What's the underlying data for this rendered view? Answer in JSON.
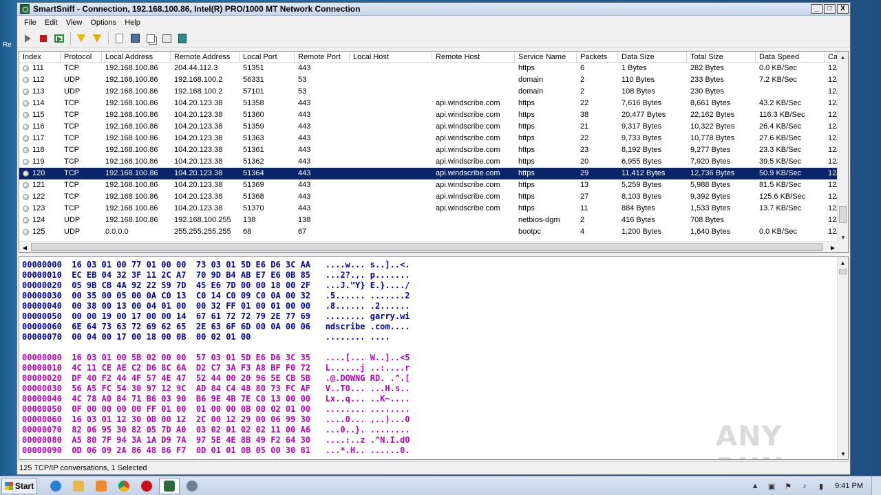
{
  "window": {
    "title": "SmartSniff - Connection, 192.168.100.86, Intel(R) PRO/1000 MT Network Connection",
    "minimize": "_",
    "maximize": "□",
    "close": "X"
  },
  "menu": [
    "File",
    "Edit",
    "View",
    "Options",
    "Help"
  ],
  "toolbar_icons": [
    "play-icon",
    "stop-icon",
    "start-capture-icon",
    "filter-icon",
    "filter-alt-icon",
    "new-doc-icon",
    "save-icon",
    "copy-icon",
    "properties-icon",
    "exit-icon"
  ],
  "columns": [
    "Index",
    "Protocol",
    "Local Address",
    "Remote Address",
    "Local Port",
    "Remote Port",
    "Local Host",
    "Remote Host",
    "Service Name",
    "Packets",
    "Data Size",
    "Total Size",
    "Data Speed",
    "Ca"
  ],
  "rows": [
    {
      "index": "111",
      "protocol": "TCP",
      "local_address": "192.168.100.86",
      "remote_address": "204.44.112.3",
      "local_port": "51351",
      "remote_port": "443",
      "local_host": "",
      "remote_host": "",
      "service": "https",
      "packets": "6",
      "data_size": "1 Bytes",
      "total_size": "282 Bytes",
      "speed": "0.0 KB/Sec",
      "ca": "12/"
    },
    {
      "index": "112",
      "protocol": "UDP",
      "local_address": "192.168.100.86",
      "remote_address": "192.168.100.2",
      "local_port": "56331",
      "remote_port": "53",
      "local_host": "",
      "remote_host": "",
      "service": "domain",
      "packets": "2",
      "data_size": "110 Bytes",
      "total_size": "233 Bytes",
      "speed": "7.2 KB/Sec",
      "ca": "12/"
    },
    {
      "index": "113",
      "protocol": "UDP",
      "local_address": "192.168.100.86",
      "remote_address": "192.168.100.2",
      "local_port": "57101",
      "remote_port": "53",
      "local_host": "",
      "remote_host": "",
      "service": "domain",
      "packets": "2",
      "data_size": "108 Bytes",
      "total_size": "230 Bytes",
      "speed": "",
      "ca": "12/"
    },
    {
      "index": "114",
      "protocol": "TCP",
      "local_address": "192.168.100.86",
      "remote_address": "104.20.123.38",
      "local_port": "51358",
      "remote_port": "443",
      "local_host": "",
      "remote_host": "api.windscribe.com",
      "service": "https",
      "packets": "22",
      "data_size": "7,616 Bytes",
      "total_size": "8,661 Bytes",
      "speed": "43.2 KB/Sec",
      "ca": "12/"
    },
    {
      "index": "115",
      "protocol": "TCP",
      "local_address": "192.168.100.86",
      "remote_address": "104.20.123.38",
      "local_port": "51360",
      "remote_port": "443",
      "local_host": "",
      "remote_host": "api.windscribe.com",
      "service": "https",
      "packets": "38",
      "data_size": "20,477 Bytes",
      "total_size": "22,162 Bytes",
      "speed": "116.3 KB/Sec",
      "ca": "12/"
    },
    {
      "index": "116",
      "protocol": "TCP",
      "local_address": "192.168.100.86",
      "remote_address": "104.20.123.38",
      "local_port": "51359",
      "remote_port": "443",
      "local_host": "",
      "remote_host": "api.windscribe.com",
      "service": "https",
      "packets": "21",
      "data_size": "9,317 Bytes",
      "total_size": "10,322 Bytes",
      "speed": "26.4 KB/Sec",
      "ca": "12/"
    },
    {
      "index": "117",
      "protocol": "TCP",
      "local_address": "192.168.100.86",
      "remote_address": "104.20.123.38",
      "local_port": "51363",
      "remote_port": "443",
      "local_host": "",
      "remote_host": "api.windscribe.com",
      "service": "https",
      "packets": "22",
      "data_size": "9,733 Bytes",
      "total_size": "10,778 Bytes",
      "speed": "27.6 KB/Sec",
      "ca": "12/"
    },
    {
      "index": "118",
      "protocol": "TCP",
      "local_address": "192.168.100.86",
      "remote_address": "104.20.123.38",
      "local_port": "51361",
      "remote_port": "443",
      "local_host": "",
      "remote_host": "api.windscribe.com",
      "service": "https",
      "packets": "23",
      "data_size": "8,192 Bytes",
      "total_size": "9,277 Bytes",
      "speed": "23.3 KB/Sec",
      "ca": "12/"
    },
    {
      "index": "119",
      "protocol": "TCP",
      "local_address": "192.168.100.86",
      "remote_address": "104.20.123.38",
      "local_port": "51362",
      "remote_port": "443",
      "local_host": "",
      "remote_host": "api.windscribe.com",
      "service": "https",
      "packets": "20",
      "data_size": "6,955 Bytes",
      "total_size": "7,920 Bytes",
      "speed": "39.5 KB/Sec",
      "ca": "12/"
    },
    {
      "index": "120",
      "protocol": "TCP",
      "local_address": "192.168.100.86",
      "remote_address": "104.20.123.38",
      "local_port": "51364",
      "remote_port": "443",
      "local_host": "",
      "remote_host": "api.windscribe.com",
      "service": "https",
      "packets": "29",
      "data_size": "11,412 Bytes",
      "total_size": "12,736 Bytes",
      "speed": "50.9 KB/Sec",
      "ca": "12/",
      "selected": true
    },
    {
      "index": "121",
      "protocol": "TCP",
      "local_address": "192.168.100.86",
      "remote_address": "104.20.123.38",
      "local_port": "51369",
      "remote_port": "443",
      "local_host": "",
      "remote_host": "api.windscribe.com",
      "service": "https",
      "packets": "13",
      "data_size": "5,259 Bytes",
      "total_size": "5,988 Bytes",
      "speed": "81.5 KB/Sec",
      "ca": "12/"
    },
    {
      "index": "122",
      "protocol": "TCP",
      "local_address": "192.168.100.86",
      "remote_address": "104.20.123.38",
      "local_port": "51368",
      "remote_port": "443",
      "local_host": "",
      "remote_host": "api.windscribe.com",
      "service": "https",
      "packets": "27",
      "data_size": "8,103 Bytes",
      "total_size": "9,392 Bytes",
      "speed": "125.6 KB/Sec",
      "ca": "12/"
    },
    {
      "index": "123",
      "protocol": "TCP",
      "local_address": "192.168.100.86",
      "remote_address": "104.20.123.38",
      "local_port": "51370",
      "remote_port": "443",
      "local_host": "",
      "remote_host": "api.windscribe.com",
      "service": "https",
      "packets": "11",
      "data_size": "884 Bytes",
      "total_size": "1,533 Bytes",
      "speed": "13.7 KB/Sec",
      "ca": "12/"
    },
    {
      "index": "124",
      "protocol": "UDP",
      "local_address": "192.168.100.86",
      "remote_address": "192.168.100.255",
      "local_port": "138",
      "remote_port": "138",
      "local_host": "",
      "remote_host": "",
      "service": "netbios-dgm",
      "packets": "2",
      "data_size": "416 Bytes",
      "total_size": "708 Bytes",
      "speed": "",
      "ca": "12/"
    },
    {
      "index": "125",
      "protocol": "UDP",
      "local_address": "0.0.0.0",
      "remote_address": "255.255.255.255",
      "local_port": "68",
      "remote_port": "67",
      "local_host": "",
      "remote_host": "",
      "service": "bootpc",
      "packets": "4",
      "data_size": "1,200 Bytes",
      "total_size": "1,640 Bytes",
      "speed": "0.0 KB/Sec",
      "ca": "12/"
    }
  ],
  "hex_block1": [
    "00000000  16 03 01 00 77 01 00 00  73 03 01 5D E6 D6 3C AA   ....w... s..]..<.",
    "00000010  EC EB 04 32 3F 11 2C A7  70 9D B4 AB E7 E6 0B 85   ...2?.,. p.......",
    "00000020  05 9B CB 4A 92 22 59 7D  45 E6 7D 00 00 18 00 2F   ...J.\"Y} E.}..../",
    "00000030  00 35 00 05 00 0A C0 13  C0 14 C0 09 C0 0A 00 32   .5...... .......2",
    "00000040  00 38 00 13 00 04 01 00  00 32 FF 01 00 01 00 00   .8...... .2......",
    "00000050  00 00 19 00 17 00 00 14  67 61 72 72 79 2E 77 69   ........ garry.wi",
    "00000060  6E 64 73 63 72 69 62 65  2E 63 6F 6D 00 0A 00 06   ndscribe .com....",
    "00000070  00 04 00 17 00 18 00 0B  00 02 01 00               ........ ...."
  ],
  "hex_block2": [
    "00000000  16 03 01 00 5B 02 00 00  57 03 01 5D E6 D6 3C 35   ....[... W..]..<5",
    "00000010  4C 11 CE AE C2 D6 8C 6A  D2 C7 3A F3 A8 BF F0 72   L......j ..:....r",
    "00000020  DF 40 F2 44 4F 57 4E 47  52 44 00 20 96 5E CB 5B   .@.DOWNG RD. .^.[",
    "00000030  56 A5 FC 54 30 97 12 9C  AD 84 C4 48 80 73 FC AF   V..T0... ...H.s..",
    "00000040  4C 78 A0 84 71 B6 03 90  B6 9E 4B 7E C0 13 00 00   Lx..q... ..K~....",
    "00000050  0F 00 00 00 00 FF 01 00  01 00 00 0B 00 02 01 00   ........ ........",
    "00000060  16 03 01 12 30 0B 00 12  2C 00 12 29 00 06 99 30   ....0... ,..)...0",
    "00000070  82 06 95 30 82 05 7D A0  03 02 01 02 02 11 00 A6   ...0..}. ........",
    "00000080  A5 80 7F 94 3A 1A D9 7A  97 5E 4E 8B 49 F2 64 30   ....:..z .^N.I.d0",
    "00000090  0D 06 09 2A 86 48 86 F7  0D 01 01 0B 05 00 30 81   ...*.H.. ......0."
  ],
  "status": "125 TCP/IP conversations, 1 Selected",
  "watermark": "ANY RUN",
  "taskbar": {
    "start_label": "Start",
    "apps": [
      "ie-icon",
      "explorer-icon",
      "media-player-icon",
      "chrome-icon",
      "opera-icon",
      "smartsniff-icon",
      "wordpad-icon"
    ],
    "clock": "9:41 PM"
  },
  "desktop_label": "Re"
}
